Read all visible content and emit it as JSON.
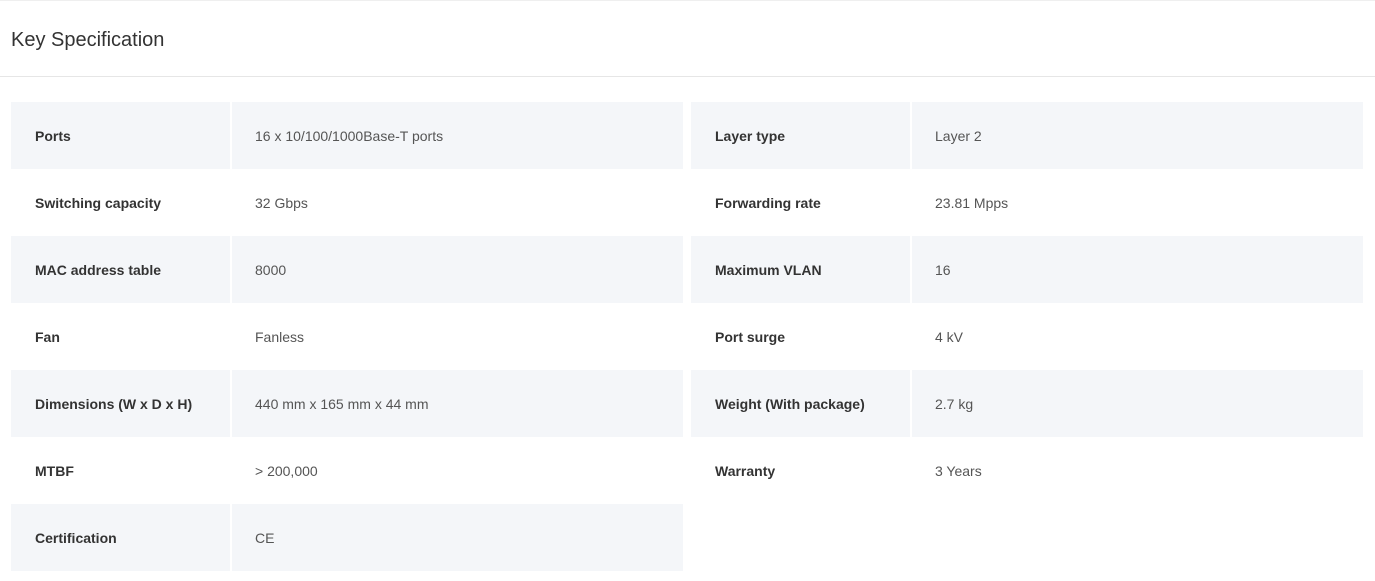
{
  "section": {
    "title": "Key Specification"
  },
  "specs": {
    "left": [
      {
        "label": "Ports",
        "value": "16 x 10/100/1000Base-T ports"
      },
      {
        "label": "Switching capacity",
        "value": "32 Gbps"
      },
      {
        "label": "MAC address table",
        "value": "8000"
      },
      {
        "label": "Fan",
        "value": "Fanless"
      },
      {
        "label": "Dimensions (W x D x H)",
        "value": "440 mm x 165 mm x 44 mm"
      },
      {
        "label": "MTBF",
        "value": "> 200,000"
      },
      {
        "label": "Certification",
        "value": "CE"
      }
    ],
    "right": [
      {
        "label": "Layer type",
        "value": "Layer 2"
      },
      {
        "label": "Forwarding rate",
        "value": "23.81 Mpps"
      },
      {
        "label": "Maximum VLAN",
        "value": "16"
      },
      {
        "label": "Port surge",
        "value": "4 kV"
      },
      {
        "label": "Weight (With package)",
        "value": "2.7 kg"
      },
      {
        "label": "Warranty",
        "value": "3 Years"
      }
    ]
  },
  "colors": {
    "row_shade": "#f4f6f9",
    "text_primary": "#333333",
    "text_secondary": "#555555"
  }
}
